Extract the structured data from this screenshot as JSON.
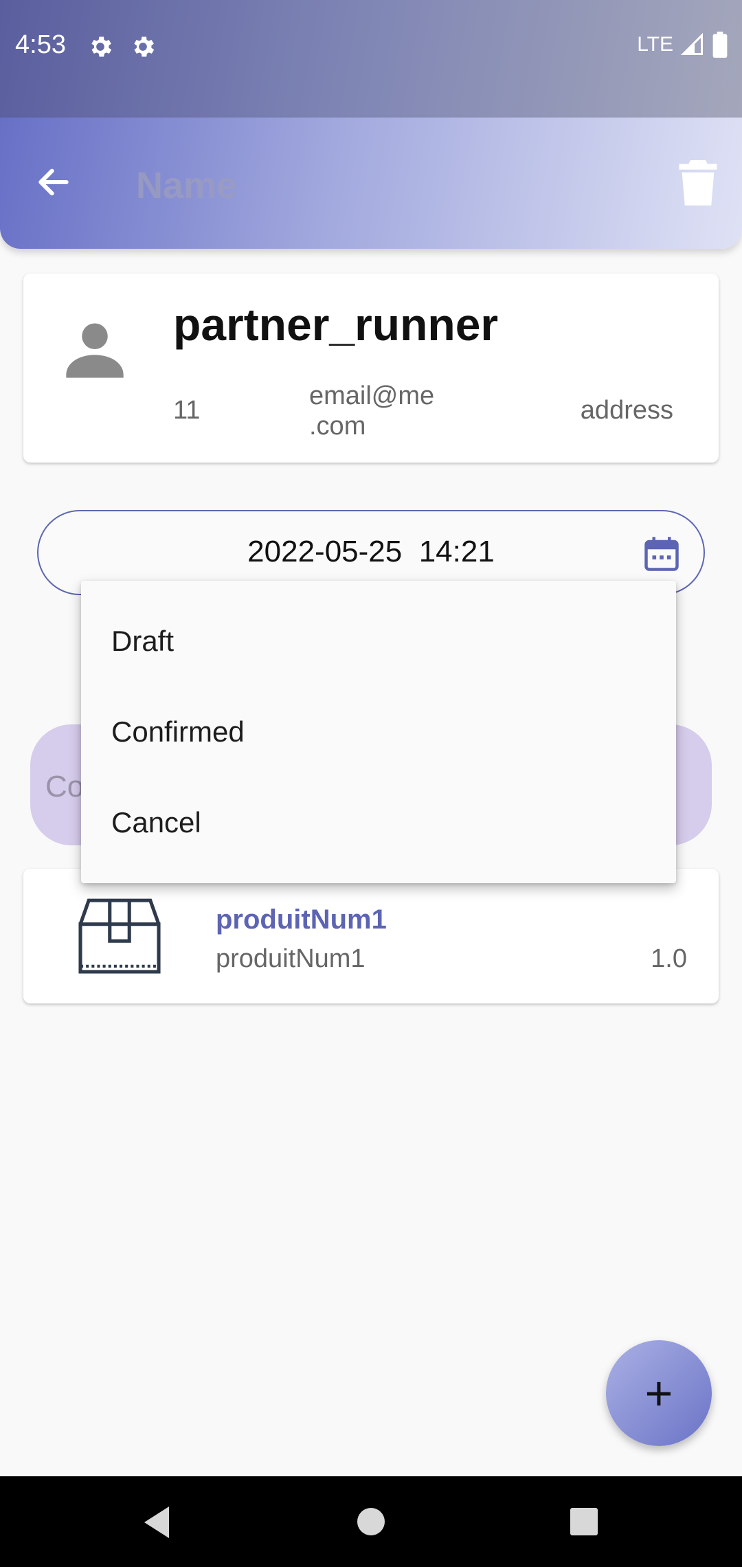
{
  "status_bar": {
    "time": "4:53",
    "network": "LTE"
  },
  "app_bar": {
    "title": "Name"
  },
  "partner": {
    "name": "partner_runner",
    "phone": "11",
    "email": "email@me\n.com",
    "address": "address"
  },
  "order": {
    "datetime": "2022-05-25  14:21",
    "state_placeholder": "Co"
  },
  "dropdown": {
    "options": [
      "Draft",
      "Confirmed",
      "Cancel"
    ]
  },
  "product": {
    "title": "produitNum1",
    "subtitle": "produitNum1",
    "quantity": "1.0"
  },
  "fab": {
    "label": "+"
  },
  "colors": {
    "accent": "#5c64b3",
    "app_bar_start": "#6770c6",
    "state_field": "#d6ccec"
  }
}
